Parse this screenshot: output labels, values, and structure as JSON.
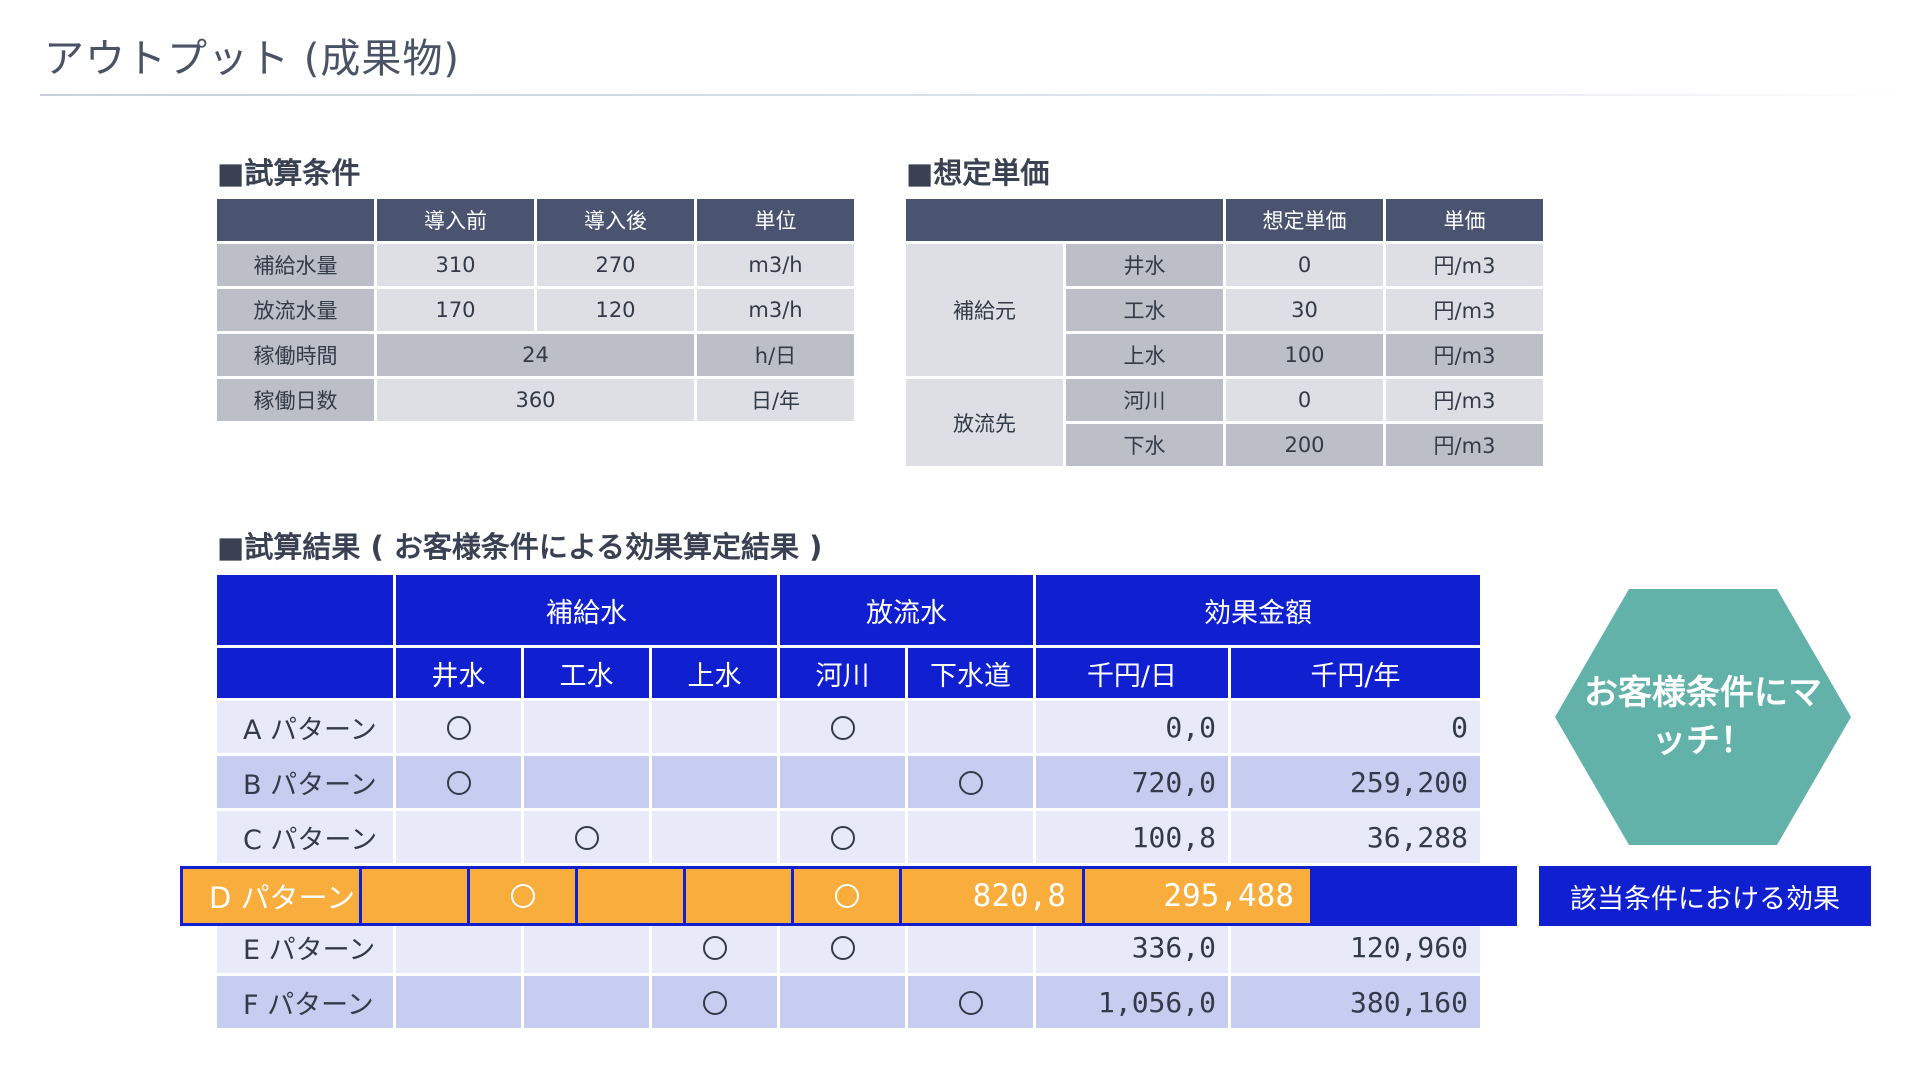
{
  "page_title": "アウトプット (成果物)",
  "conditions": {
    "title": "■試算条件",
    "headers": [
      "",
      "導入前",
      "導入後",
      "単位"
    ],
    "rows": [
      {
        "label": "補給水量",
        "before": "310",
        "after": "270",
        "unit": "m3/h"
      },
      {
        "label": "放流水量",
        "before": "170",
        "after": "120",
        "unit": "m3/h"
      },
      {
        "label": "稼働時間",
        "value": "24",
        "unit": "h/日"
      },
      {
        "label": "稼働日数",
        "value": "360",
        "unit": "日/年"
      }
    ]
  },
  "prices": {
    "title": "■想定単価",
    "headers": [
      "",
      "",
      "想定単価",
      "単価"
    ],
    "groups": [
      {
        "label": "補給元",
        "rows": [
          {
            "name": "井水",
            "price": "0",
            "unit": "円/m3"
          },
          {
            "name": "工水",
            "price": "30",
            "unit": "円/m3"
          },
          {
            "name": "上水",
            "price": "100",
            "unit": "円/m3"
          }
        ]
      },
      {
        "label": "放流先",
        "rows": [
          {
            "name": "河川",
            "price": "0",
            "unit": "円/m3"
          },
          {
            "name": "下水",
            "price": "200",
            "unit": "円/m3"
          }
        ]
      }
    ]
  },
  "results": {
    "title": "■試算結果 ( お客様条件による効果算定結果 )",
    "group_headers": [
      "補給水",
      "放流水",
      "効果金額"
    ],
    "sub_headers": [
      "井水",
      "工水",
      "上水",
      "河川",
      "下水道",
      "千円/日",
      "千円/年"
    ],
    "rows": [
      {
        "name": "A パターン",
        "marks": [
          true,
          false,
          false,
          true,
          false
        ],
        "per_day": "0,0",
        "per_year": "0"
      },
      {
        "name": "B パターン",
        "marks": [
          true,
          false,
          false,
          false,
          true
        ],
        "per_day": "720,0",
        "per_year": "259,200"
      },
      {
        "name": "C パターン",
        "marks": [
          false,
          true,
          false,
          true,
          false
        ],
        "per_day": "100,8",
        "per_year": "36,288"
      },
      {
        "name": "D パターン",
        "marks": [
          false,
          true,
          false,
          false,
          true
        ],
        "per_day": "820,8",
        "per_year": "295,488",
        "highlighted": true
      },
      {
        "name": "E パターン",
        "marks": [
          false,
          false,
          true,
          true,
          false
        ],
        "per_day": "336,0",
        "per_year": "120,960"
      },
      {
        "name": "F パターン",
        "marks": [
          false,
          false,
          true,
          false,
          true
        ],
        "per_day": "1,056,0",
        "per_year": "380,160"
      }
    ]
  },
  "callout": {
    "hexagon_text": "お客様条件にマッチ！",
    "label": "該当条件における効果"
  },
  "colors": {
    "header_slate": "#4a5470",
    "header_blue": "#1020d0",
    "highlight_orange": "#f9ad3c",
    "hexagon_teal": "#62b2aa"
  }
}
